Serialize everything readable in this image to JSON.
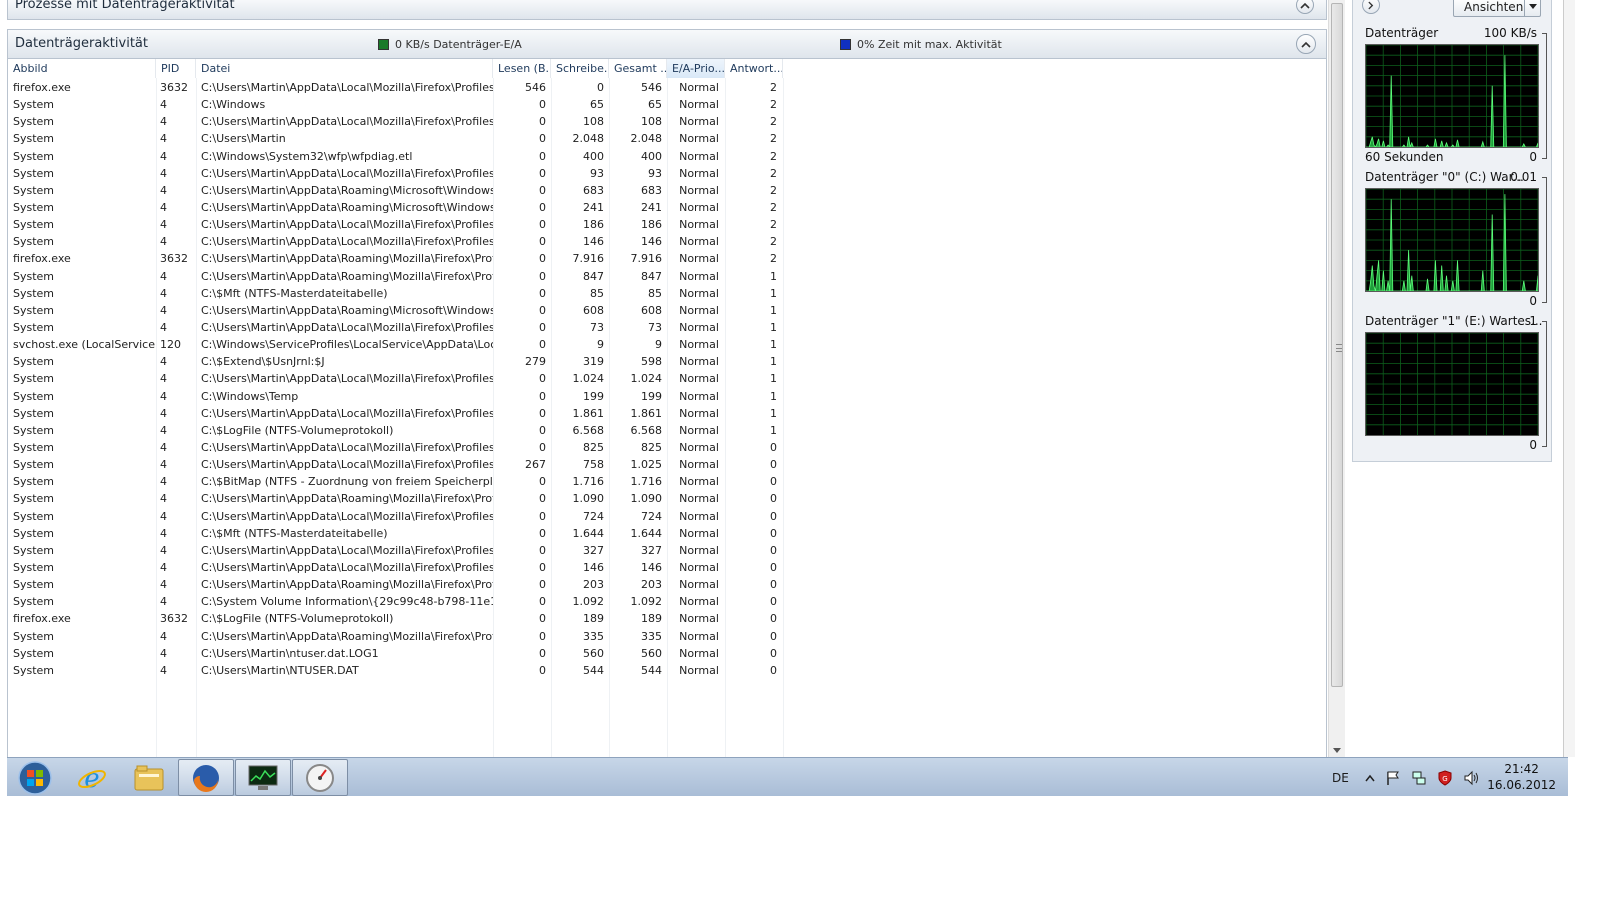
{
  "top_section": {
    "title": "Prozesse mit Datenträgeraktivität"
  },
  "disk_section": {
    "title": "Datenträgeraktivität",
    "io_stat": "0 KB/s Datenträger-E/A",
    "io_color": "#1a8a2a",
    "activity_stat": "0% Zeit mit max. Aktivität",
    "activity_color": "#1030c0"
  },
  "columns": [
    "Abbild",
    "PID",
    "Datei",
    "Lesen (B...",
    "Schreibe...",
    "Gesamt ...",
    "E/A-Prio...",
    "Antwort..."
  ],
  "sorted_column": "E/A-Prio...",
  "rows": [
    [
      "firefox.exe",
      "3632",
      "C:\\Users\\Martin\\AppData\\Local\\Mozilla\\Firefox\\Profiles\\4...",
      "546",
      "0",
      "546",
      "Normal",
      "2"
    ],
    [
      "System",
      "4",
      "C:\\Windows",
      "0",
      "65",
      "65",
      "Normal",
      "2"
    ],
    [
      "System",
      "4",
      "C:\\Users\\Martin\\AppData\\Local\\Mozilla\\Firefox\\Profiles\\4...",
      "0",
      "108",
      "108",
      "Normal",
      "2"
    ],
    [
      "System",
      "4",
      "C:\\Users\\Martin",
      "0",
      "2.048",
      "2.048",
      "Normal",
      "2"
    ],
    [
      "System",
      "4",
      "C:\\Windows\\System32\\wfp\\wfpdiag.etl",
      "0",
      "400",
      "400",
      "Normal",
      "2"
    ],
    [
      "System",
      "4",
      "C:\\Users\\Martin\\AppData\\Local\\Mozilla\\Firefox\\Profiles\\4...",
      "0",
      "93",
      "93",
      "Normal",
      "2"
    ],
    [
      "System",
      "4",
      "C:\\Users\\Martin\\AppData\\Roaming\\Microsoft\\Windows\\R...",
      "0",
      "683",
      "683",
      "Normal",
      "2"
    ],
    [
      "System",
      "4",
      "C:\\Users\\Martin\\AppData\\Roaming\\Microsoft\\Windows\\R...",
      "0",
      "241",
      "241",
      "Normal",
      "2"
    ],
    [
      "System",
      "4",
      "C:\\Users\\Martin\\AppData\\Local\\Mozilla\\Firefox\\Profiles\\4...",
      "0",
      "186",
      "186",
      "Normal",
      "2"
    ],
    [
      "System",
      "4",
      "C:\\Users\\Martin\\AppData\\Local\\Mozilla\\Firefox\\Profiles\\4...",
      "0",
      "146",
      "146",
      "Normal",
      "2"
    ],
    [
      "firefox.exe",
      "3632",
      "C:\\Users\\Martin\\AppData\\Roaming\\Mozilla\\Firefox\\Profile...",
      "0",
      "7.916",
      "7.916",
      "Normal",
      "2"
    ],
    [
      "System",
      "4",
      "C:\\Users\\Martin\\AppData\\Roaming\\Mozilla\\Firefox\\Profile...",
      "0",
      "847",
      "847",
      "Normal",
      "1"
    ],
    [
      "System",
      "4",
      "C:\\$Mft (NTFS-Masterdateitabelle)",
      "0",
      "85",
      "85",
      "Normal",
      "1"
    ],
    [
      "System",
      "4",
      "C:\\Users\\Martin\\AppData\\Roaming\\Microsoft\\Windows\\R...",
      "0",
      "608",
      "608",
      "Normal",
      "1"
    ],
    [
      "System",
      "4",
      "C:\\Users\\Martin\\AppData\\Local\\Mozilla\\Firefox\\Profiles\\4...",
      "0",
      "73",
      "73",
      "Normal",
      "1"
    ],
    [
      "svchost.exe (LocalServiceN...",
      "120",
      "C:\\Windows\\ServiceProfiles\\LocalService\\AppData\\Local\\la...",
      "0",
      "9",
      "9",
      "Normal",
      "1"
    ],
    [
      "System",
      "4",
      "C:\\$Extend\\$UsnJrnl:$J",
      "279",
      "319",
      "598",
      "Normal",
      "1"
    ],
    [
      "System",
      "4",
      "C:\\Users\\Martin\\AppData\\Local\\Mozilla\\Firefox\\Profiles\\4...",
      "0",
      "1.024",
      "1.024",
      "Normal",
      "1"
    ],
    [
      "System",
      "4",
      "C:\\Windows\\Temp",
      "0",
      "199",
      "199",
      "Normal",
      "1"
    ],
    [
      "System",
      "4",
      "C:\\Users\\Martin\\AppData\\Local\\Mozilla\\Firefox\\Profiles\\4...",
      "0",
      "1.861",
      "1.861",
      "Normal",
      "1"
    ],
    [
      "System",
      "4",
      "C:\\$LogFile (NTFS-Volumeprotokoll)",
      "0",
      "6.568",
      "6.568",
      "Normal",
      "1"
    ],
    [
      "System",
      "4",
      "C:\\Users\\Martin\\AppData\\Local\\Mozilla\\Firefox\\Profiles\\4...",
      "0",
      "825",
      "825",
      "Normal",
      "0"
    ],
    [
      "System",
      "4",
      "C:\\Users\\Martin\\AppData\\Local\\Mozilla\\Firefox\\Profiles\\4...",
      "267",
      "758",
      "1.025",
      "Normal",
      "0"
    ],
    [
      "System",
      "4",
      "C:\\$BitMap (NTFS - Zuordnung von freiem Speicherplatz)",
      "0",
      "1.716",
      "1.716",
      "Normal",
      "0"
    ],
    [
      "System",
      "4",
      "C:\\Users\\Martin\\AppData\\Roaming\\Mozilla\\Firefox\\Profile...",
      "0",
      "1.090",
      "1.090",
      "Normal",
      "0"
    ],
    [
      "System",
      "4",
      "C:\\Users\\Martin\\AppData\\Local\\Mozilla\\Firefox\\Profiles\\4...",
      "0",
      "724",
      "724",
      "Normal",
      "0"
    ],
    [
      "System",
      "4",
      "C:\\$Mft (NTFS-Masterdateitabelle)",
      "0",
      "1.644",
      "1.644",
      "Normal",
      "0"
    ],
    [
      "System",
      "4",
      "C:\\Users\\Martin\\AppData\\Local\\Mozilla\\Firefox\\Profiles\\4...",
      "0",
      "327",
      "327",
      "Normal",
      "0"
    ],
    [
      "System",
      "4",
      "C:\\Users\\Martin\\AppData\\Local\\Mozilla\\Firefox\\Profiles\\4...",
      "0",
      "146",
      "146",
      "Normal",
      "0"
    ],
    [
      "System",
      "4",
      "C:\\Users\\Martin\\AppData\\Roaming\\Mozilla\\Firefox\\Profile...",
      "0",
      "203",
      "203",
      "Normal",
      "0"
    ],
    [
      "System",
      "4",
      "C:\\System Volume Information\\{29c99c48-b798-11e1-ae42...",
      "0",
      "1.092",
      "1.092",
      "Normal",
      "0"
    ],
    [
      "firefox.exe",
      "3632",
      "C:\\$LogFile (NTFS-Volumeprotokoll)",
      "0",
      "189",
      "189",
      "Normal",
      "0"
    ],
    [
      "System",
      "4",
      "C:\\Users\\Martin\\AppData\\Roaming\\Mozilla\\Firefox\\Profile...",
      "0",
      "335",
      "335",
      "Normal",
      "0"
    ],
    [
      "System",
      "4",
      "C:\\Users\\Martin\\ntuser.dat.LOG1",
      "0",
      "560",
      "560",
      "Normal",
      "0"
    ],
    [
      "System",
      "4",
      "C:\\Users\\Martin\\NTUSER.DAT",
      "0",
      "544",
      "544",
      "Normal",
      "0"
    ]
  ],
  "side_panel": {
    "views_label": "Ansichten",
    "graphs": [
      {
        "label": "Datenträger",
        "top_right": "100 KB/s",
        "bottom_left": "60 Sekunden",
        "bottom_right": "0",
        "activity": [
          0,
          0,
          0,
          5,
          10,
          2,
          0,
          3,
          8,
          0,
          0,
          6,
          0,
          0,
          2,
          0,
          70,
          0,
          0,
          0,
          0,
          0,
          0,
          0,
          2,
          0,
          0,
          10,
          0,
          4,
          0,
          0,
          0,
          0,
          0,
          0,
          0,
          0,
          0,
          2,
          0,
          0,
          0,
          0,
          8,
          0,
          0,
          0,
          6,
          0,
          0,
          4,
          0,
          0,
          0,
          2,
          0,
          0,
          7,
          0,
          0,
          0,
          0,
          0,
          0,
          0,
          0,
          0,
          0,
          0,
          0,
          0,
          0,
          0,
          5,
          0,
          0,
          0,
          0,
          0,
          60,
          0,
          0,
          0,
          0,
          0,
          0,
          0,
          90,
          0,
          0,
          0,
          0,
          0,
          0,
          0,
          0,
          0,
          0,
          0,
          3,
          0,
          0,
          0,
          0,
          0,
          0,
          0,
          0,
          4
        ]
      },
      {
        "label": "Datenträger \"0\" (C:) War...",
        "top_right": "0.01",
        "bottom_left": "",
        "bottom_right": "0",
        "activity": [
          0,
          0,
          0,
          10,
          25,
          5,
          0,
          15,
          30,
          0,
          0,
          20,
          0,
          0,
          10,
          0,
          90,
          0,
          0,
          0,
          0,
          0,
          0,
          0,
          10,
          0,
          0,
          40,
          0,
          15,
          0,
          0,
          0,
          0,
          0,
          0,
          0,
          0,
          0,
          12,
          0,
          0,
          0,
          0,
          30,
          0,
          0,
          0,
          25,
          0,
          0,
          15,
          0,
          0,
          0,
          10,
          0,
          0,
          30,
          0,
          0,
          0,
          0,
          0,
          0,
          0,
          0,
          0,
          0,
          0,
          0,
          0,
          0,
          0,
          20,
          0,
          0,
          0,
          0,
          0,
          75,
          0,
          0,
          0,
          0,
          0,
          0,
          0,
          95,
          0,
          0,
          0,
          0,
          0,
          0,
          0,
          0,
          0,
          0,
          0,
          10,
          0,
          0,
          0,
          0,
          0,
          0,
          0,
          0,
          15
        ]
      },
      {
        "label": "Datenträger \"1\" (E:) Wartes...",
        "top_right": "1",
        "bottom_left": "",
        "bottom_right": "0",
        "activity": []
      }
    ]
  },
  "taskbar": {
    "apps": [
      "start-orb",
      "internet-explorer",
      "explorer",
      "firefox",
      "resource-monitor",
      "performance-gauge"
    ],
    "active": [
      "firefox",
      "resource-monitor",
      "performance-gauge"
    ],
    "language": "DE",
    "time": "21:42",
    "date": "16.06.2012"
  }
}
